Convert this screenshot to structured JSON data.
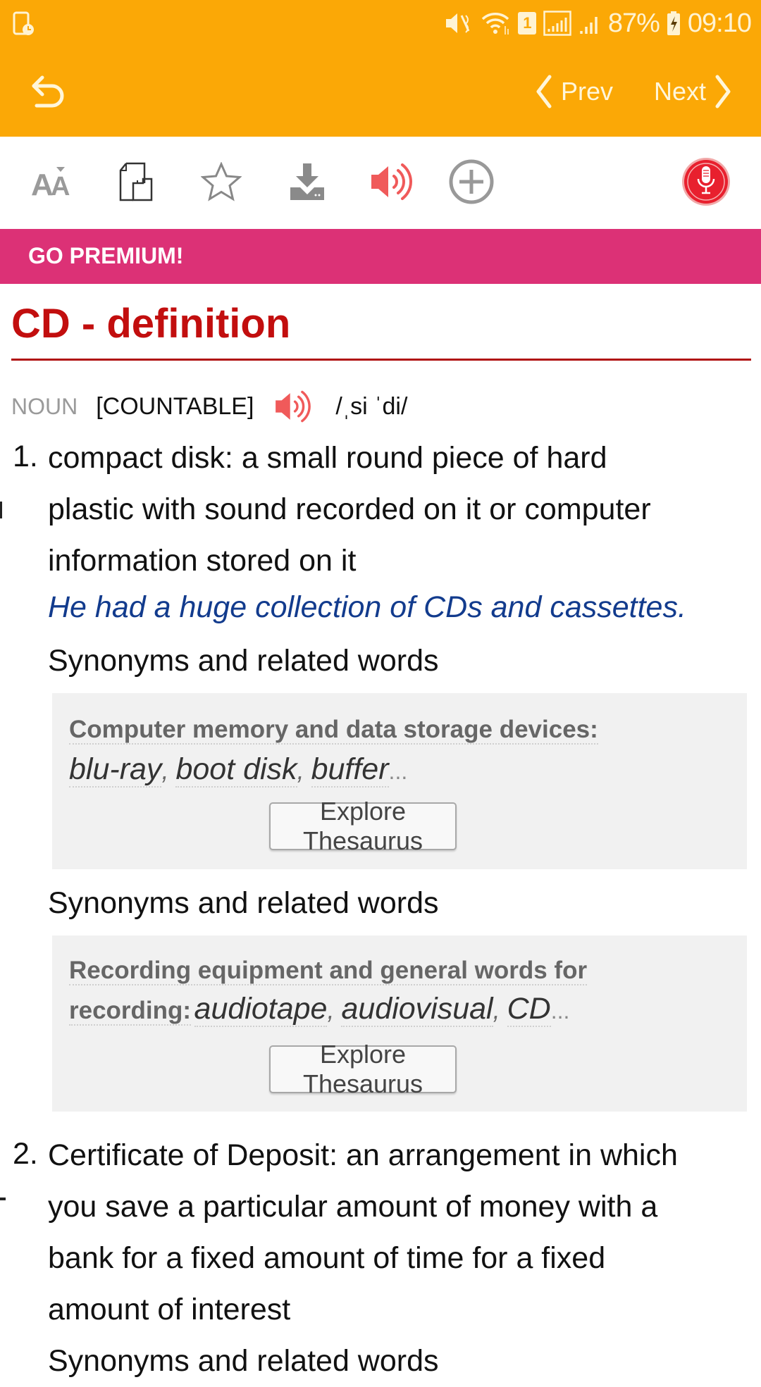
{
  "status_bar": {
    "battery": "87%",
    "time": "09:10",
    "sim_slot": "1",
    "icons": [
      "screen-time-icon",
      "mute-icon",
      "wifi-icon",
      "sim-icon",
      "signal-icon",
      "signal-icon-2",
      "battery-charging-icon"
    ]
  },
  "toolbar": {
    "prev_label": "Prev",
    "next_label": "Next"
  },
  "icon_bar": {
    "items": [
      "font-size-icon",
      "copy-icon",
      "star-icon",
      "download-icon",
      "speaker-icon",
      "add-icon",
      "microphone-icon"
    ]
  },
  "banner": {
    "label": "GO PREMIUM!"
  },
  "entry": {
    "title": "CD - definition",
    "part_of_speech": "NOUN",
    "grammar": "[COUNTABLE]",
    "pronunciation": "/ˌsi ˈdi/",
    "senses": [
      {
        "number": "1.",
        "lines": [
          "compact disk: a small round piece of hard",
          "plastic with sound recorded on it or computer",
          "information stored on it"
        ],
        "example": "He had a huge collection of CDs and cassettes.",
        "synonym_groups": [
          {
            "heading": "Synonyms and related words",
            "category": "Computer memory and data storage devices:",
            "words": [
              "blu-ray",
              "boot disk",
              "buffer"
            ],
            "more": "...",
            "button": "Explore Thesaurus"
          },
          {
            "heading": "Synonyms and related words",
            "category_line1": "Recording equipment and general words for",
            "category_line2": "recording:",
            "words": [
              "audiotape",
              "audiovisual",
              "CD"
            ],
            "more": "...",
            "button": "Explore Thesaurus"
          }
        ]
      },
      {
        "number": "2.",
        "lines": [
          "Certificate of Deposit: an arrangement in which",
          "you save a particular amount of money with a",
          "bank for a fixed amount of time for a fixed",
          "amount of interest"
        ],
        "next_heading": "Synonyms and related words"
      }
    ]
  },
  "colors": {
    "app_bar": "#FBA806",
    "premium_banner": "#DC3176",
    "title_red": "#C20E0E",
    "example_blue": "#123B8D",
    "speaker_red": "#F05A5A",
    "mic_red": "#E8202E"
  }
}
